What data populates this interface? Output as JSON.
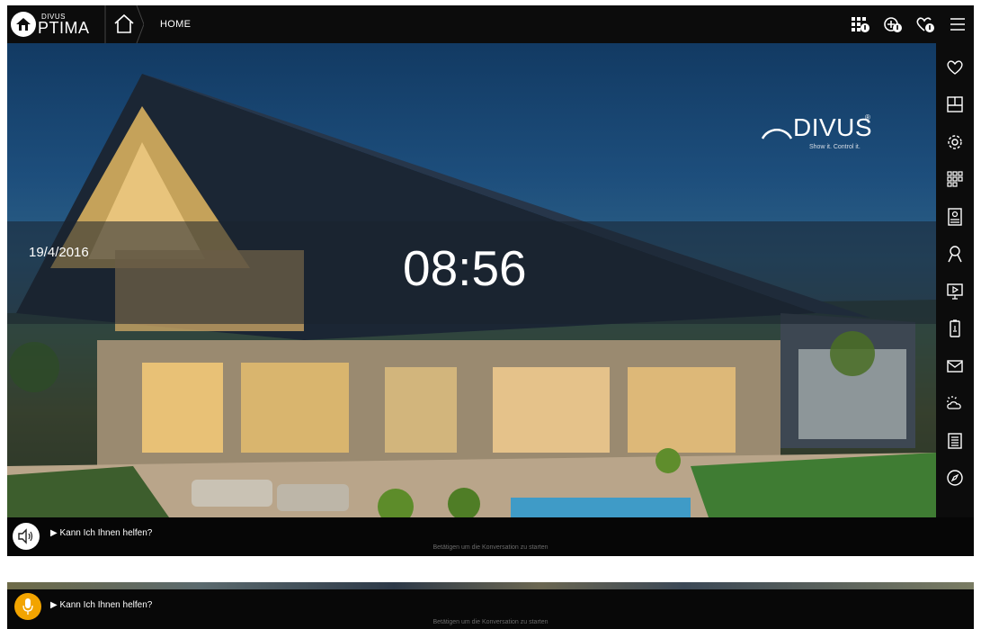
{
  "app": {
    "brand_small": "DIVUS",
    "brand_big": "PTIMA"
  },
  "breadcrumb": {
    "label": "HOME"
  },
  "header_icons": [
    "qr-grid-info-icon",
    "add-globe-info-icon",
    "heart-info-icon",
    "menu-icon"
  ],
  "sidebar_icons": [
    "heart-icon",
    "floorplan-icon",
    "settings-gear-icon",
    "apps-grid-icon",
    "intercom-icon",
    "user-search-icon",
    "presentation-icon",
    "battery-phone-icon",
    "mail-icon",
    "weather-icon",
    "notes-icon",
    "compass-icon"
  ],
  "home": {
    "date": "19/4/2016",
    "time": "08:56"
  },
  "brand_logo": {
    "name": "DIVUS",
    "registered": "®",
    "tagline": "Show it. Control it."
  },
  "voice": {
    "prompt": "▶ Kann Ich Ihnen helfen?",
    "hint": "Betätigen um die Konversation zu starten"
  },
  "voice_active": {
    "prompt": "▶ Kann Ich Ihnen helfen?",
    "hint": "Betätigen um die Konversation zu starten"
  },
  "colors": {
    "accent": "#f2a400",
    "bar": "#0c0c0c"
  }
}
